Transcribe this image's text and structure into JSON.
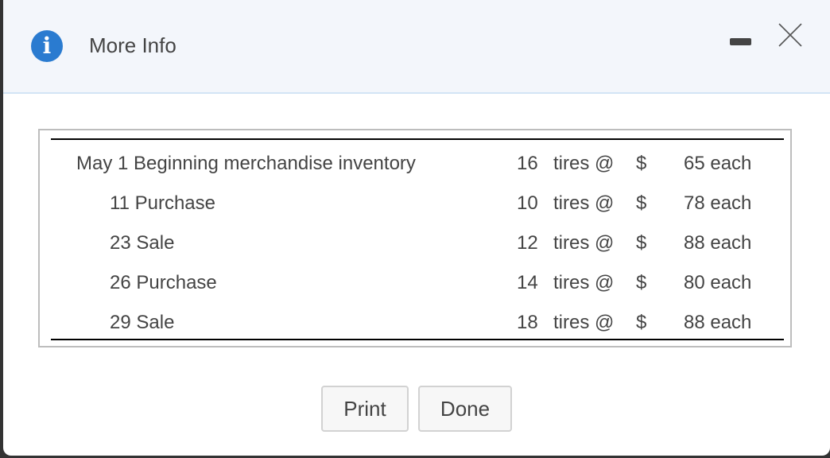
{
  "dialog": {
    "title": "More Info",
    "icons": {
      "info": "info-icon",
      "minimize": "minimize-icon",
      "close": "close-icon"
    },
    "accent_color": "#2a7bd0"
  },
  "table": {
    "rows": [
      {
        "date": "May 1",
        "description": "Beginning merchandise inventory",
        "quantity": "16",
        "unit": "tires @",
        "currency": "$",
        "price": "65 each"
      },
      {
        "date": "11",
        "description": "Purchase",
        "quantity": "10",
        "unit": "tires @",
        "currency": "$",
        "price": "78 each"
      },
      {
        "date": "23",
        "description": "Sale",
        "quantity": "12",
        "unit": "tires @",
        "currency": "$",
        "price": "88 each"
      },
      {
        "date": "26",
        "description": "Purchase",
        "quantity": "14",
        "unit": "tires @",
        "currency": "$",
        "price": "80 each"
      },
      {
        "date": "29",
        "description": "Sale",
        "quantity": "18",
        "unit": "tires @",
        "currency": "$",
        "price": "88 each"
      }
    ]
  },
  "buttons": {
    "print": "Print",
    "done": "Done"
  }
}
